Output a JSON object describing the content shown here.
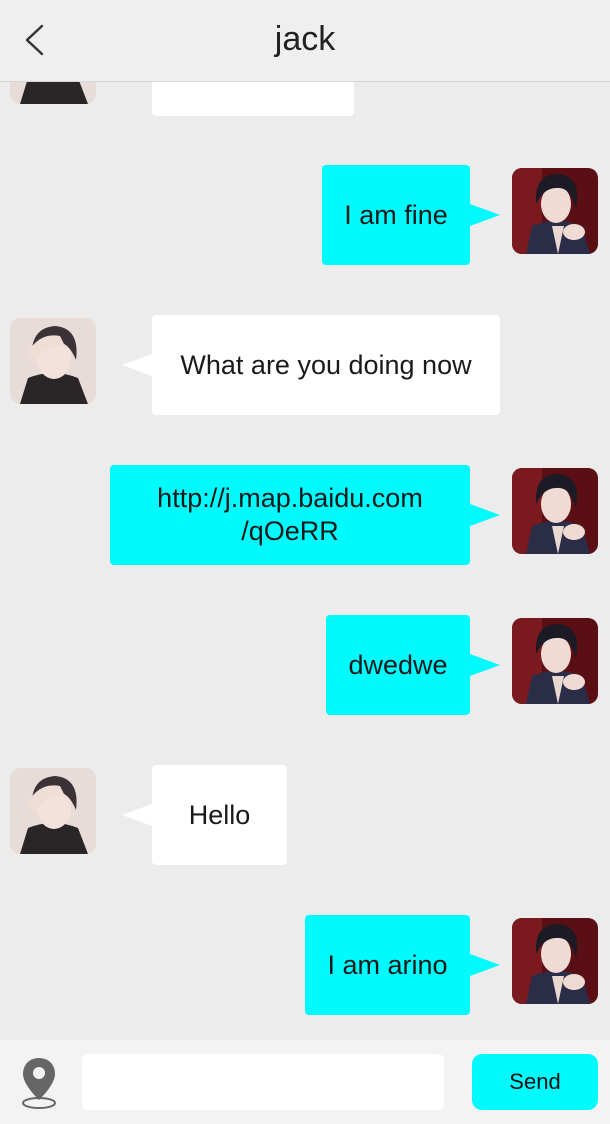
{
  "header": {
    "title": "jack",
    "back_icon": "chevron-left-icon"
  },
  "messages": [
    {
      "direction": "in",
      "text": "",
      "partial": true
    },
    {
      "direction": "out",
      "text": "I am fine"
    },
    {
      "direction": "in",
      "text": "What are you doing now"
    },
    {
      "direction": "out",
      "text": "http://j.map.baidu.com\n/qOeRR"
    },
    {
      "direction": "out",
      "text": "dwedwe"
    },
    {
      "direction": "in",
      "text": "Hello"
    },
    {
      "direction": "out",
      "text": "I am arino"
    }
  ],
  "composer": {
    "location_icon": "location-pin-icon",
    "input_value": "",
    "input_placeholder": "",
    "send_label": "Send"
  },
  "colors": {
    "accent": "#00fafe",
    "background": "#ececec",
    "incoming_bubble": "#ffffff"
  }
}
